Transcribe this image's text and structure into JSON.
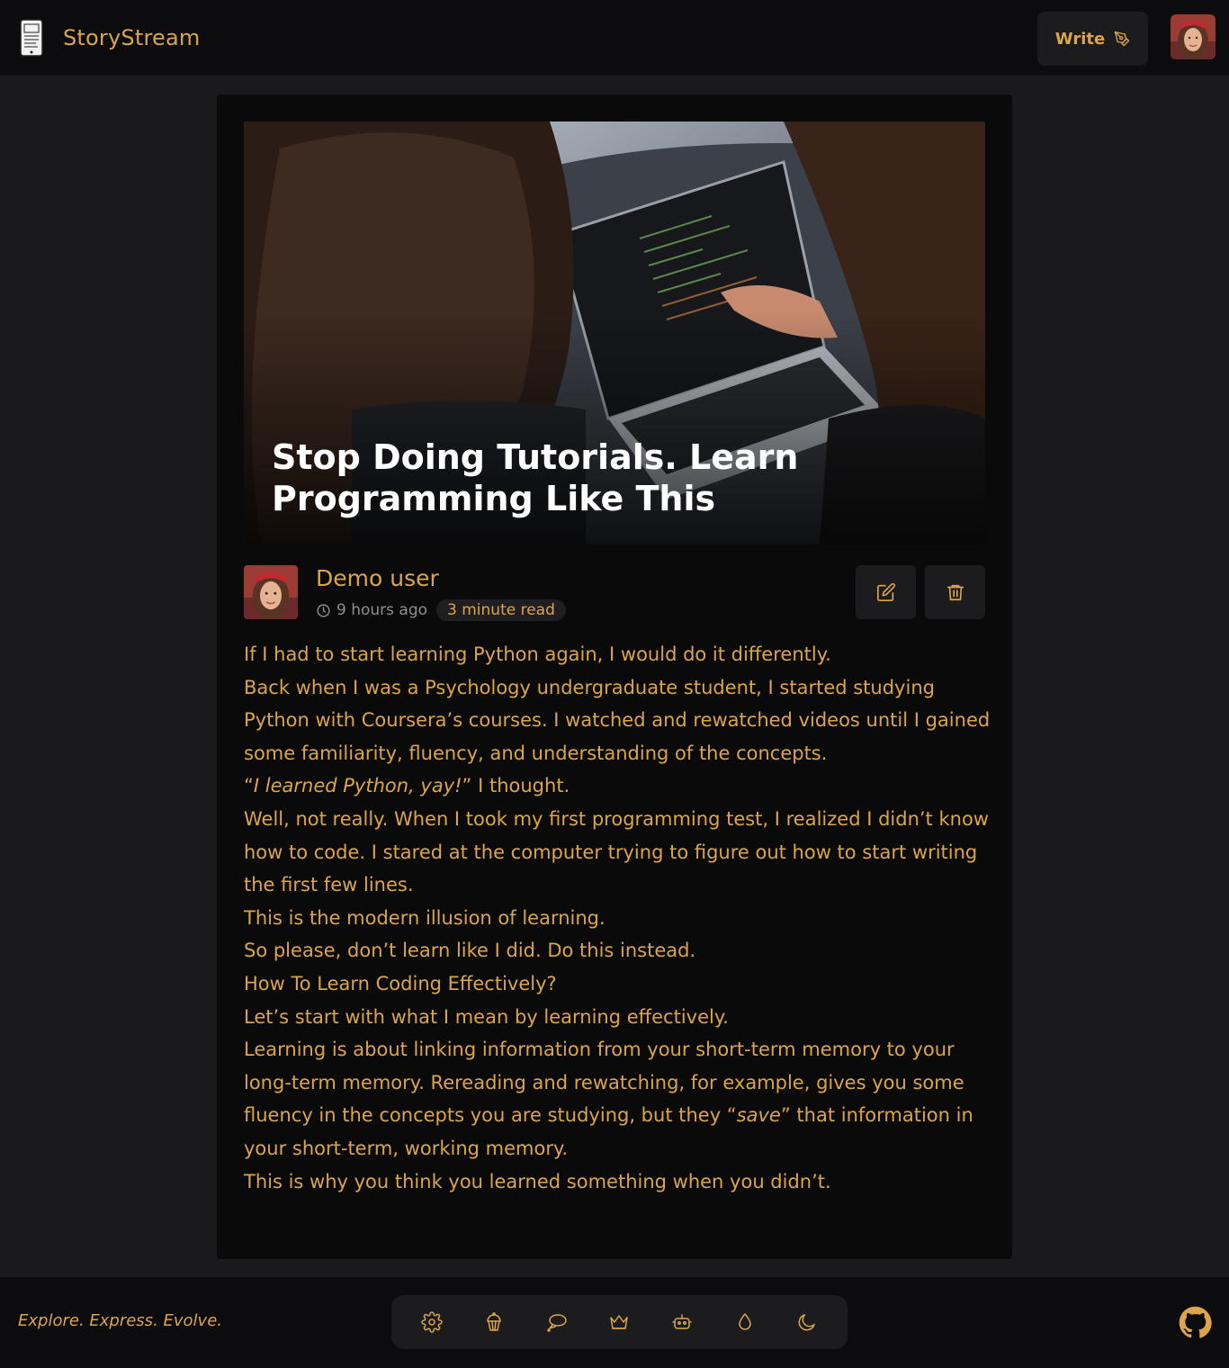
{
  "header": {
    "brand": "StoryStream",
    "write_label": "Write"
  },
  "article": {
    "title": "Stop Doing Tutorials. Learn Programming Like This",
    "author": "Demo user",
    "time_ago": "9 hours ago",
    "read_time": "3 minute read",
    "paragraphs": [
      "If I had to start learning Python again, I would do it differently.",
      "Back when I was a Psychology undergraduate student, I started studying Python with Coursera’s courses. I watched and rewatched videos until I gained some familiarity, fluency, and understanding of the concepts.",
      "“I learned Python, yay!” I thought.",
      "Well, not really. When I took my first programming test, I realized I didn’t know how to code. I stared at the computer trying to figure out how to start writing the first few lines.",
      "This is the modern illusion of learning.",
      "So please, don’t learn like I did. Do this instead.",
      "How To Learn Coding Effectively?",
      "Let’s start with what I mean by learning effectively.",
      "Learning is about linking information from your short-term memory to your long-term memory. Rereading and rewatching, for example, gives you some fluency in the concepts you are studying, but they “save” that information in your short-term, working memory.",
      "This is why you think you learned something when you didn’t."
    ],
    "quote_italic": "I learned Python, yay!",
    "quote_rest": " I thought.",
    "p9_before": "Learning is about linking information from your short-term memory to your long-term memory. Rereading and rewatching, for example, gives you some fluency in the concepts you are studying, but they “",
    "p9_italic": "save",
    "p9_after": "” that information in your short-term, working memory."
  },
  "footer": {
    "tagline": "Explore. Express. Evolve.",
    "theme_icons": [
      "gear-icon",
      "cupcake-icon",
      "speech-bubble-icon",
      "crown-icon",
      "robot-icon",
      "drop-icon",
      "moon-icon"
    ]
  },
  "colors": {
    "accent": "#dca54c",
    "background": "#1a1a1c",
    "card": "#0a0a0b",
    "header": "#0c0c0e"
  }
}
